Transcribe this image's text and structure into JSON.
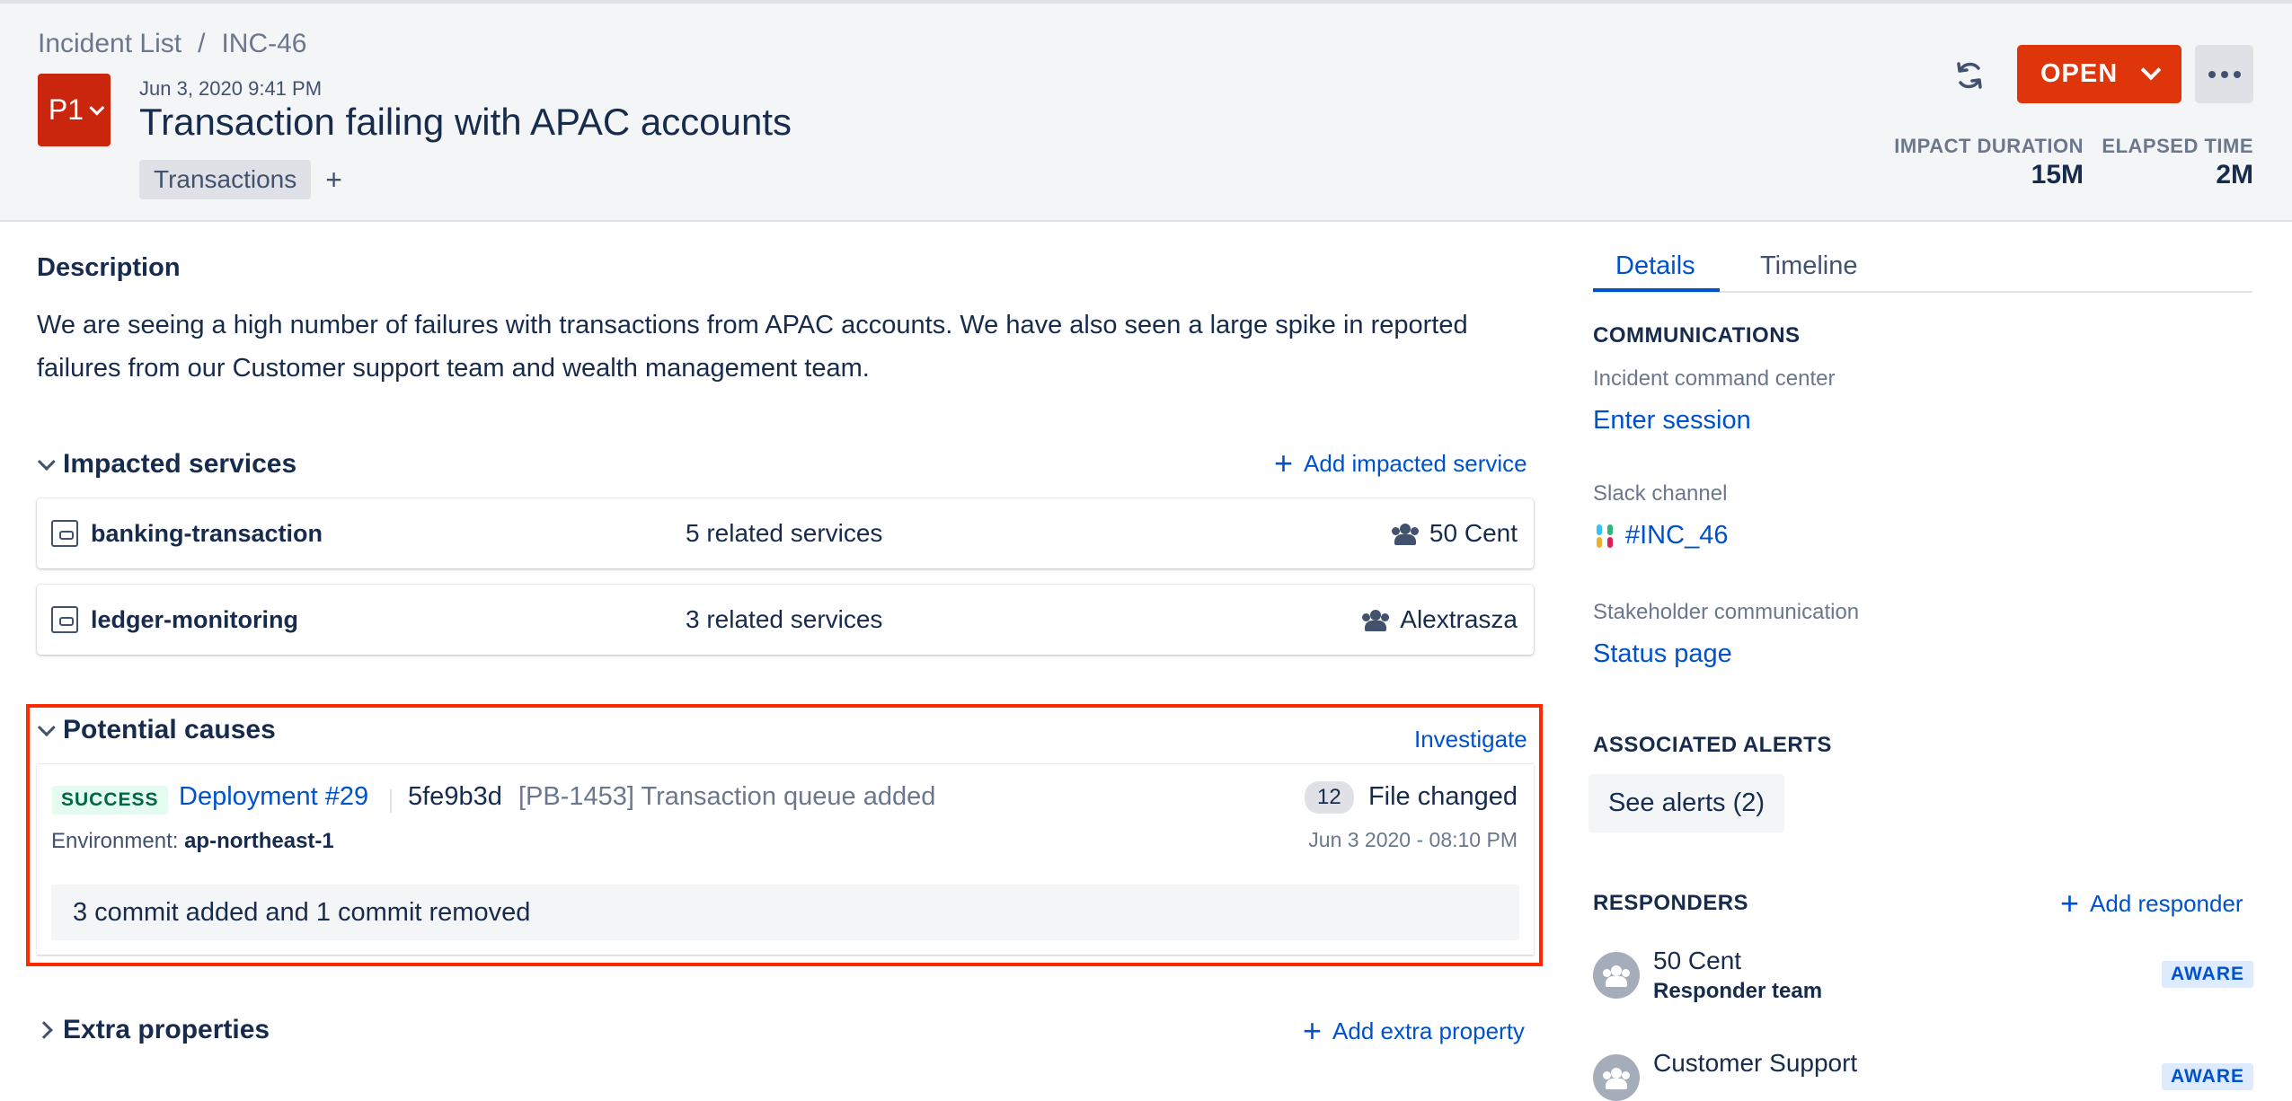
{
  "breadcrumb": {
    "parent": "Incident List",
    "separator": "/",
    "current": "INC-46"
  },
  "incident": {
    "priority": "P1",
    "date": "Jun 3, 2020 9:41 PM",
    "title": "Transaction failing with APAC accounts",
    "tags": [
      "Transactions"
    ],
    "add_tag": "+"
  },
  "toolbar": {
    "status_label": "OPEN",
    "refresh_icon": "refresh-icon",
    "more_icon": "more-icon"
  },
  "metrics": {
    "impact_duration_label": "IMPACT DURATION",
    "impact_duration_value": "15M",
    "elapsed_time_label": "ELAPSED TIME",
    "elapsed_time_value": "2M"
  },
  "description": {
    "heading": "Description",
    "text": "We are seeing a high number of failures with transactions from APAC accounts. We have also seen a large spike in reported failures from our Customer support team and wealth management team."
  },
  "impacted_services": {
    "heading": "Impacted services",
    "add_label": "Add impacted service",
    "items": [
      {
        "name": "banking-transaction",
        "related": "5 related services",
        "owner": "50 Cent"
      },
      {
        "name": "ledger-monitoring",
        "related": "3 related services",
        "owner": "Alextrasza"
      }
    ]
  },
  "potential_causes": {
    "heading": "Potential causes",
    "investigate_label": "Investigate",
    "item": {
      "status": "SUCCESS",
      "deployment": "Deployment #29",
      "commit_hash": "5fe9b3d",
      "commit_message": "[PB-1453] Transaction queue added",
      "file_count": "12",
      "file_label": "File changed",
      "environment_label": "Environment:",
      "environment_value": "ap-northeast-1",
      "timestamp": "Jun 3 2020 - 08:10 PM",
      "summary": "3 commit added and 1 commit removed"
    }
  },
  "extra_properties": {
    "heading": "Extra properties",
    "add_label": "Add extra property"
  },
  "sidebar": {
    "tabs": [
      {
        "label": "Details"
      },
      {
        "label": "Timeline"
      }
    ],
    "communications": {
      "heading": "COMMUNICATIONS",
      "command_center_label": "Incident command center",
      "command_center_link": "Enter session",
      "slack_label": "Slack channel",
      "slack_link": "#INC_46",
      "stakeholder_label": "Stakeholder communication",
      "stakeholder_link": "Status page"
    },
    "alerts": {
      "heading": "ASSOCIATED ALERTS",
      "button": "See alerts (2)"
    },
    "responders": {
      "heading": "RESPONDERS",
      "add_label": "Add responder",
      "items": [
        {
          "name": "50 Cent",
          "role": "Responder team",
          "status": "AWARE"
        },
        {
          "name": "Customer Support",
          "role": "",
          "status": "AWARE"
        }
      ]
    }
  },
  "colors": {
    "accent": "#0052cc",
    "danger": "#de350b",
    "priority": "#c9260d",
    "highlight": "#ff2a00",
    "success": "#006644"
  }
}
